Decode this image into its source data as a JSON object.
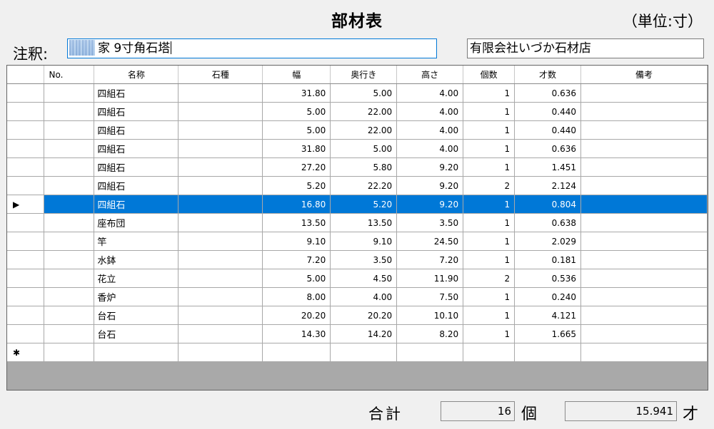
{
  "header": {
    "title": "部材表",
    "unit": "（単位:寸）"
  },
  "annotation": {
    "label": "注釈:",
    "value": "家 9寸角石塔",
    "company": "有限会社いづか石材店"
  },
  "table": {
    "columns": [
      "",
      "No.",
      "名称",
      "石種",
      "幅",
      "奥行き",
      "高さ",
      "個数",
      "才数",
      "備考"
    ],
    "rows": [
      {
        "marker": "",
        "no": "",
        "name": "四組石",
        "stone": "",
        "w": "31.80",
        "d": "5.00",
        "h": "4.00",
        "cnt": "1",
        "sai": "0.636",
        "note": ""
      },
      {
        "marker": "",
        "no": "",
        "name": "四組石",
        "stone": "",
        "w": "5.00",
        "d": "22.00",
        "h": "4.00",
        "cnt": "1",
        "sai": "0.440",
        "note": ""
      },
      {
        "marker": "",
        "no": "",
        "name": "四組石",
        "stone": "",
        "w": "5.00",
        "d": "22.00",
        "h": "4.00",
        "cnt": "1",
        "sai": "0.440",
        "note": ""
      },
      {
        "marker": "",
        "no": "",
        "name": "四組石",
        "stone": "",
        "w": "31.80",
        "d": "5.00",
        "h": "4.00",
        "cnt": "1",
        "sai": "0.636",
        "note": ""
      },
      {
        "marker": "",
        "no": "",
        "name": "四組石",
        "stone": "",
        "w": "27.20",
        "d": "5.80",
        "h": "9.20",
        "cnt": "1",
        "sai": "1.451",
        "note": ""
      },
      {
        "marker": "",
        "no": "",
        "name": "四組石",
        "stone": "",
        "w": "5.20",
        "d": "22.20",
        "h": "9.20",
        "cnt": "2",
        "sai": "2.124",
        "note": ""
      },
      {
        "marker": "▶",
        "no": "",
        "name": "四組石",
        "stone": "",
        "w": "16.80",
        "d": "5.20",
        "h": "9.20",
        "cnt": "1",
        "sai": "0.804",
        "note": ""
      },
      {
        "marker": "",
        "no": "",
        "name": "座布団",
        "stone": "",
        "w": "13.50",
        "d": "13.50",
        "h": "3.50",
        "cnt": "1",
        "sai": "0.638",
        "note": ""
      },
      {
        "marker": "",
        "no": "",
        "name": "竿",
        "stone": "",
        "w": "9.10",
        "d": "9.10",
        "h": "24.50",
        "cnt": "1",
        "sai": "2.029",
        "note": ""
      },
      {
        "marker": "",
        "no": "",
        "name": "水鉢",
        "stone": "",
        "w": "7.20",
        "d": "3.50",
        "h": "7.20",
        "cnt": "1",
        "sai": "0.181",
        "note": ""
      },
      {
        "marker": "",
        "no": "",
        "name": "花立",
        "stone": "",
        "w": "5.00",
        "d": "4.50",
        "h": "11.90",
        "cnt": "2",
        "sai": "0.536",
        "note": ""
      },
      {
        "marker": "",
        "no": "",
        "name": "香炉",
        "stone": "",
        "w": "8.00",
        "d": "4.00",
        "h": "7.50",
        "cnt": "1",
        "sai": "0.240",
        "note": ""
      },
      {
        "marker": "",
        "no": "",
        "name": "台石",
        "stone": "",
        "w": "20.20",
        "d": "20.20",
        "h": "10.10",
        "cnt": "1",
        "sai": "4.121",
        "note": ""
      },
      {
        "marker": "",
        "no": "",
        "name": "台石",
        "stone": "",
        "w": "14.30",
        "d": "14.20",
        "h": "8.20",
        "cnt": "1",
        "sai": "1.665",
        "note": ""
      }
    ],
    "selected_index": 6,
    "new_row_marker": "✱"
  },
  "summary": {
    "label": "合計",
    "count": "16",
    "count_unit": "個",
    "sai": "15.941",
    "sai_unit": "才"
  },
  "colors": {
    "selection": "#0078d7",
    "focus_border": "#0078d7"
  }
}
